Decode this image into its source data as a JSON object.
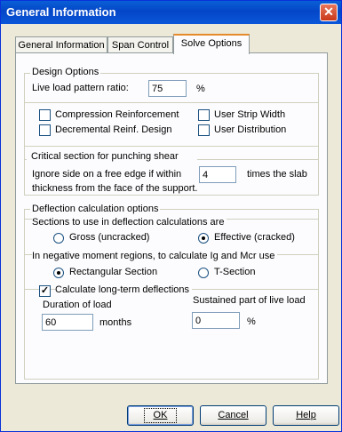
{
  "window": {
    "title": "General Information",
    "close_glyph": "✕"
  },
  "tabs": [
    {
      "label": "General Information"
    },
    {
      "label": "Span Control"
    },
    {
      "label": "Solve Options"
    }
  ],
  "design_options": {
    "title": "Design Options",
    "live_load_label": "Live load pattern ratio:",
    "live_load_value": "75",
    "live_load_unit": "%",
    "compression_reinforcement": {
      "label": "Compression Reinforcement",
      "checked": false
    },
    "decremental_reinf": {
      "label": "Decremental Reinf. Design",
      "checked": false
    },
    "user_strip_width": {
      "label": "User Strip Width",
      "checked": false
    },
    "user_distribution": {
      "label": "User Distribution",
      "checked": false
    }
  },
  "punching_shear": {
    "title": "Critical section for punching shear",
    "line1_before": "Ignore side on a free edge if within",
    "value": "4",
    "line1_after": "times the slab",
    "line2": "thickness from the face of the support."
  },
  "deflection": {
    "title": "Deflection calculation options",
    "sections_title": "Sections to use in deflection calculations are",
    "gross_label": "Gross (uncracked)",
    "effective_label": "Effective (cracked)",
    "selected_section": "effective",
    "negative_title": "In negative moment regions, to calculate Ig and Mcr use",
    "rect_label": "Rectangular Section",
    "tsection_label": "T-Section",
    "selected_negative": "rectangular",
    "long_term_label": "Calculate long-term deflections",
    "long_term_checked": true,
    "duration_label": "Duration of load",
    "duration_value": "60",
    "duration_unit": "months",
    "sustained_label": "Sustained part of live load",
    "sustained_value": "0",
    "sustained_unit": "%"
  },
  "buttons": {
    "ok": "OK",
    "cancel": "Cancel",
    "help": "Help"
  }
}
